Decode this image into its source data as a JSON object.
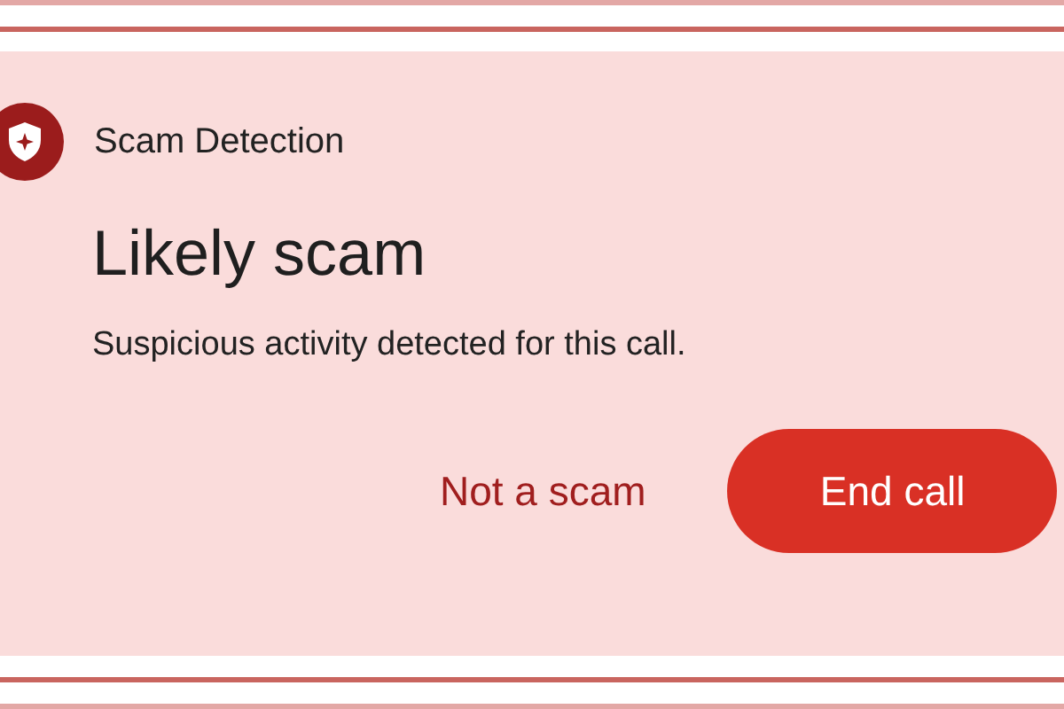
{
  "header": {
    "title": "Scam Detection"
  },
  "headline": "Likely scam",
  "message": "Suspicious activity detected for this call.",
  "buttons": [
    {
      "label": "Not a scam",
      "kind": "text"
    },
    {
      "label": "End call",
      "kind": "filled"
    }
  ]
}
